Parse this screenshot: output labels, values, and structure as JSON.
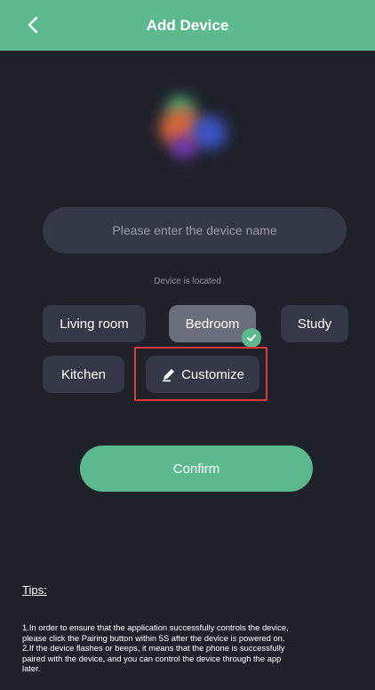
{
  "header": {
    "title": "Add Device"
  },
  "device_name_input": {
    "placeholder": "Please enter the device name",
    "value": ""
  },
  "location": {
    "label": "Device is located",
    "rooms": [
      {
        "label": "Living room",
        "selected": false
      },
      {
        "label": "Bedroom",
        "selected": true
      },
      {
        "label": "Study",
        "selected": false
      },
      {
        "label": "Kitchen",
        "selected": false
      }
    ],
    "customize_label": "Customize"
  },
  "confirm_label": "Confirm",
  "tips": {
    "title": "Tips:",
    "lines": [
      "1.In order to ensure that the application successfully controls the device,",
      "please click the Pairing button within 5S after the device is powered on.",
      "2.If the device flashes or beeps, it means that the phone is successfully",
      "paired with the device, and you can control the device through the app",
      "later."
    ]
  },
  "colors": {
    "accent": "#5cb98e",
    "background": "#1f222b",
    "button": "#353846",
    "selected_button": "#6a6d7a",
    "highlight": "#e03a3a"
  },
  "icons": {
    "back": "chevron-left-icon",
    "device": "device-image",
    "selected": "check-icon",
    "customize": "pen-icon"
  }
}
